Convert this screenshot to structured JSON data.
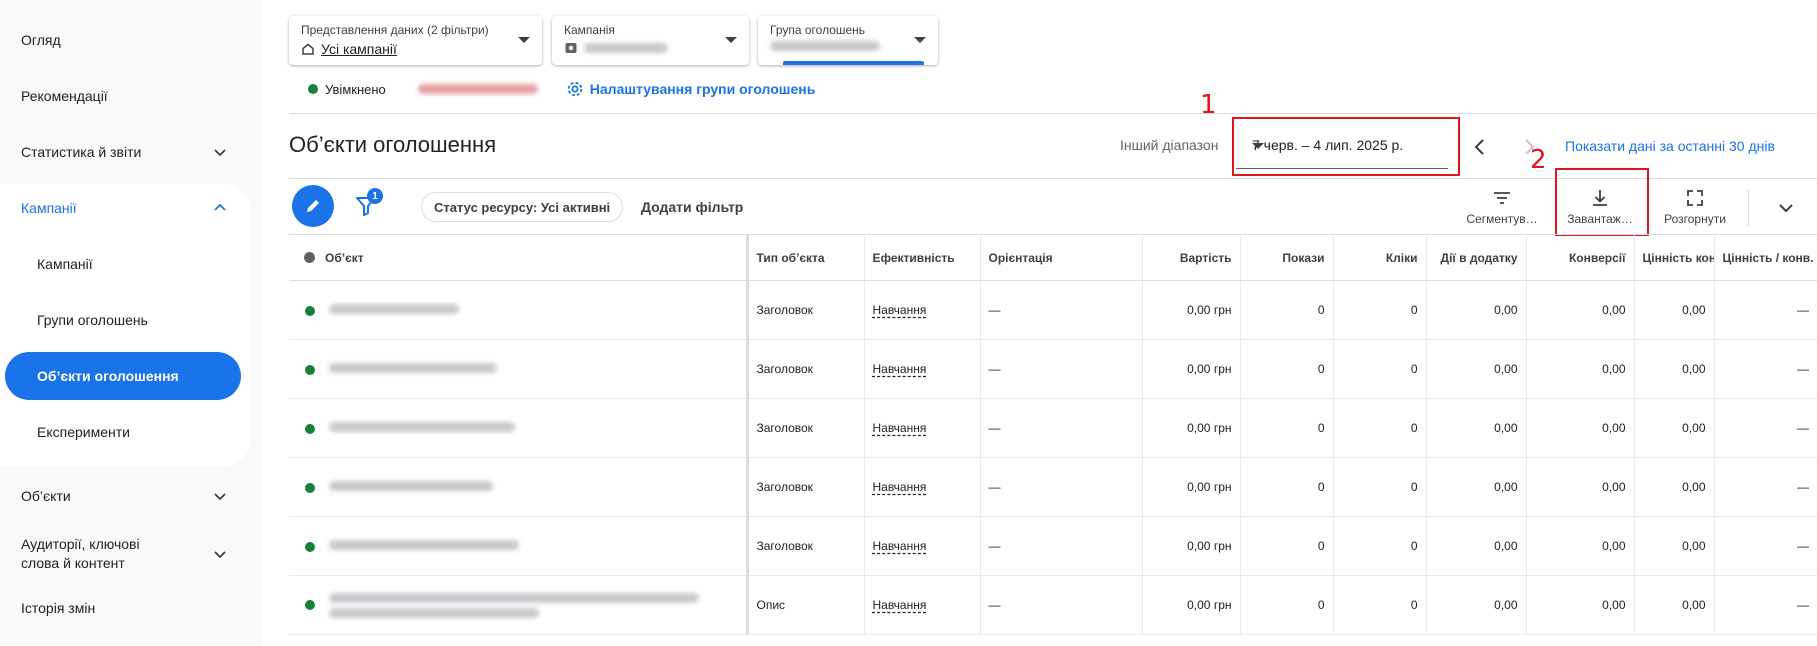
{
  "sidebar": {
    "items": [
      {
        "label": "Огляд"
      },
      {
        "label": "Рекомендації"
      },
      {
        "label": "Статистика й звіти"
      },
      {
        "label": "Кампанії"
      },
      {
        "label": "Об’єкти"
      },
      {
        "label": "Аудиторії, ключові слова й контент"
      },
      {
        "label": "Історія змін"
      }
    ],
    "sub_items": [
      {
        "label": "Кампанії"
      },
      {
        "label": "Групи оголошень"
      },
      {
        "label": "Об’єкти оголошення"
      },
      {
        "label": "Експерименти"
      }
    ]
  },
  "selectors": {
    "view": {
      "caption": "Представлення даних (2 фільтри)",
      "value": "Усі кампанії"
    },
    "campaign": {
      "caption": "Кампанія"
    },
    "ad_group": {
      "caption": "Група оголошень"
    }
  },
  "status": {
    "enabled": "Увімкнено",
    "settings_link": "Налаштування групи оголошень"
  },
  "page": {
    "title": "Об’єкти оголошення"
  },
  "date": {
    "range_label": "Інший діапазон",
    "value": "7 черв. – 4 лип. 2025 р.",
    "show_30": "Показати дані за останні 30 днів"
  },
  "annotations": {
    "one": "1",
    "two": "2"
  },
  "toolbar": {
    "filter_badge": "1",
    "status_chip": "Статус ресурсу: Усі активні",
    "add_filter": "Додати фільтр",
    "segment": "Сегментув…",
    "download": "Завантаж…",
    "expand": "Розгорнути"
  },
  "table": {
    "headers": [
      "Об’єкт",
      "Тип об’єкта",
      "Ефективність",
      "Орієнтація",
      "Вартість",
      "Покази",
      "Кліки",
      "Дії в додатку",
      "Конверсії",
      "Цінність конв.",
      "Цінність / конв."
    ],
    "rows": [
      {
        "type": "Заголовок",
        "eff": "Навчання",
        "orient": "—",
        "cost": "0,00 грн",
        "impr": "0",
        "clicks": "0",
        "app": "0,00",
        "conv": "0,00",
        "value": "0,00",
        "vpc": "—"
      },
      {
        "type": "Заголовок",
        "eff": "Навчання",
        "orient": "—",
        "cost": "0,00 грн",
        "impr": "0",
        "clicks": "0",
        "app": "0,00",
        "conv": "0,00",
        "value": "0,00",
        "vpc": "—"
      },
      {
        "type": "Заголовок",
        "eff": "Навчання",
        "orient": "—",
        "cost": "0,00 грн",
        "impr": "0",
        "clicks": "0",
        "app": "0,00",
        "conv": "0,00",
        "value": "0,00",
        "vpc": "—"
      },
      {
        "type": "Заголовок",
        "eff": "Навчання",
        "orient": "—",
        "cost": "0,00 грн",
        "impr": "0",
        "clicks": "0",
        "app": "0,00",
        "conv": "0,00",
        "value": "0,00",
        "vpc": "—"
      },
      {
        "type": "Заголовок",
        "eff": "Навчання",
        "orient": "—",
        "cost": "0,00 грн",
        "impr": "0",
        "clicks": "0",
        "app": "0,00",
        "conv": "0,00",
        "value": "0,00",
        "vpc": "—"
      },
      {
        "type": "Опис",
        "eff": "Навчання",
        "orient": "—",
        "cost": "0,00 грн",
        "impr": "0",
        "clicks": "0",
        "app": "0,00",
        "conv": "0,00",
        "value": "0,00",
        "vpc": "—"
      }
    ]
  },
  "colors": {
    "accent": "#1a73e8",
    "enabled": "#188038",
    "annotation": "#e0161f"
  }
}
